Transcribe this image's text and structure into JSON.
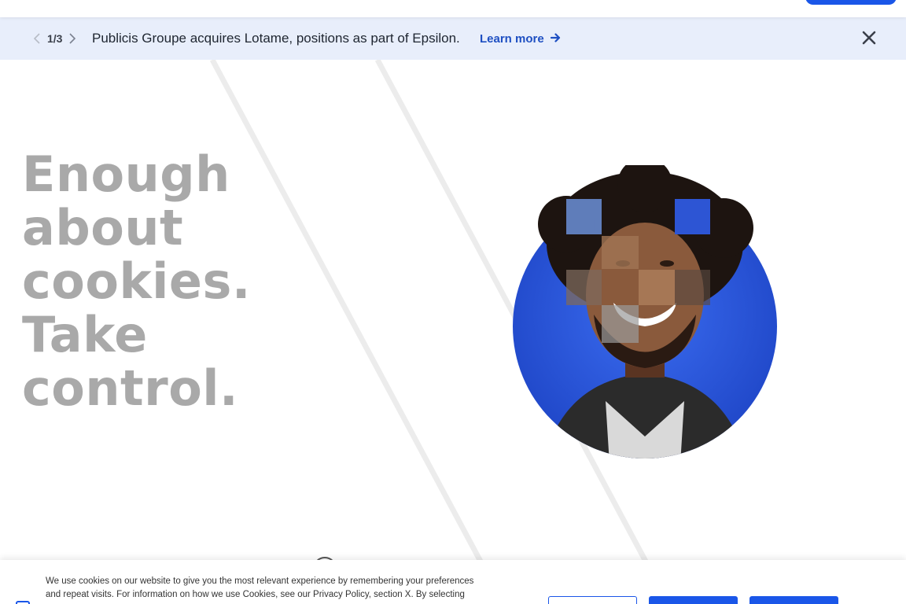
{
  "announcement": {
    "counter": "1/3",
    "message": "Publicis Groupe acquires Lotame, positions as part of Epsilon.",
    "link_label": "Learn more"
  },
  "hero": {
    "headline_lines": [
      "Enough about",
      "cookies. Take",
      "control."
    ]
  },
  "cookie_banner": {
    "text_line1": "We use cookies on our website to give you the most relevant experience by remembering your preferences",
    "text_line2": "and repeat visits. For information on how we use Cookies, see our Privacy Policy, section X. By selecting"
  },
  "colors": {
    "accent": "#1a56e8",
    "banner_bg": "#e8eefb",
    "link": "#1e4fc2",
    "headline": "#a9a9a9"
  },
  "icons": {
    "prev": "chevron-left-icon",
    "next": "chevron-right-icon",
    "link_arrow": "arrow-right-icon",
    "close": "close-icon"
  }
}
